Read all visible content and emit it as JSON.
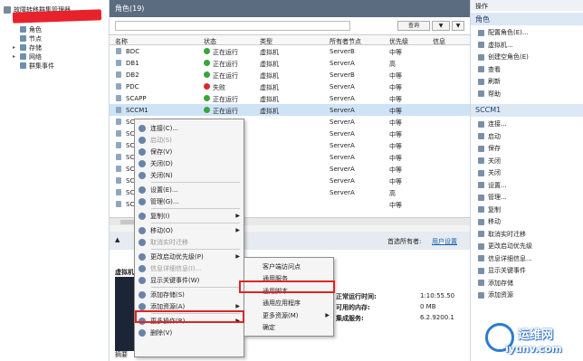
{
  "tree": {
    "root": "故障转移群集管理器",
    "items": [
      {
        "label": "角色",
        "expandable": false
      },
      {
        "label": "节点",
        "expandable": false
      },
      {
        "label": "存储",
        "expandable": true
      },
      {
        "label": "网络",
        "expandable": true
      },
      {
        "label": "群集事件",
        "expandable": false
      }
    ]
  },
  "center": {
    "title": "角色(19)",
    "filter": {
      "placeholder": "",
      "query_btn": "查询",
      "save_btn": "▼",
      "clear_btn": "▼"
    },
    "columns": [
      "名称",
      "状态",
      "类型",
      "所有者节点",
      "优先级",
      "信息"
    ],
    "rows": [
      {
        "name": "BDC",
        "status": "正在运行",
        "type": "虚拟机",
        "owner": "ServerB",
        "priority": "中等",
        "fail": false
      },
      {
        "name": "DB1",
        "status": "正在运行",
        "type": "虚拟机",
        "owner": "ServerA",
        "priority": "高",
        "fail": false
      },
      {
        "name": "DB2",
        "status": "正在运行",
        "type": "虚拟机",
        "owner": "ServerB",
        "priority": "中等",
        "fail": false
      },
      {
        "name": "PDC",
        "status": "失败",
        "type": "虚拟机",
        "owner": "ServerA",
        "priority": "中等",
        "fail": true
      },
      {
        "name": "SCAPP",
        "status": "正在运行",
        "type": "虚拟机",
        "owner": "ServerA",
        "priority": "中等",
        "fail": false
      },
      {
        "name": "SCCM1",
        "status": "正在运行",
        "type": "虚拟机",
        "owner": "ServerA",
        "priority": "中等",
        "fail": false
      },
      {
        "name": "SCD",
        "status": "",
        "type": "",
        "owner": "ServerA",
        "priority": "中等",
        "fail": false
      },
      {
        "name": "SCD",
        "status": "",
        "type": "",
        "owner": "ServerA",
        "priority": "中等",
        "fail": false
      },
      {
        "name": "SCD",
        "status": "",
        "type": "",
        "owner": "ServerA",
        "priority": "中等",
        "fail": false
      },
      {
        "name": "SCD",
        "status": "",
        "type": "",
        "owner": "ServerA",
        "priority": "中等",
        "fail": false
      },
      {
        "name": "SCD",
        "status": "",
        "type": "",
        "owner": "ServerA",
        "priority": "中等",
        "fail": false
      },
      {
        "name": "SCD",
        "status": "",
        "type": "",
        "owner": "ServerA",
        "priority": "中等",
        "fail": false
      },
      {
        "name": "SCD",
        "status": "",
        "type": "",
        "owner": "ServerA",
        "priority": "高",
        "fail": false
      },
      {
        "name": "SCD",
        "status": "",
        "type": "",
        "owner": "",
        "priority": "中等",
        "fail": false
      }
    ],
    "bottom": {
      "preferred_owner_label": "首选所有者:",
      "preferred_owner_link": "用户设置",
      "vm_label": "虚拟机",
      "tab_summary": "摘要",
      "uptime_label": "正常运行时间:",
      "uptime_value": "1:10:55.50",
      "mem_label": "可用的内存:",
      "mem_value": "0 MB",
      "integration_label": "集成服务:",
      "integration_value": "6.2.9200.1"
    }
  },
  "context_menu": [
    {
      "label": "连接(C)...",
      "disabled": false,
      "submenu": false
    },
    {
      "label": "启动(S)",
      "disabled": true,
      "submenu": false
    },
    {
      "label": "保存(V)",
      "disabled": false,
      "submenu": false
    },
    {
      "label": "关闭(D)",
      "disabled": false,
      "submenu": false
    },
    {
      "label": "关闭(N)",
      "disabled": false,
      "submenu": false
    },
    {
      "label": "设置(E)...",
      "disabled": false,
      "submenu": false
    },
    {
      "label": "管理(G)...",
      "disabled": false,
      "submenu": false
    },
    {
      "label": "复制(I)",
      "disabled": false,
      "submenu": true
    },
    {
      "label": "移动(O)",
      "disabled": false,
      "submenu": true
    },
    {
      "label": "取消实时迁移",
      "disabled": true,
      "submenu": false
    },
    {
      "label": "更改启动优先级(P)",
      "disabled": false,
      "submenu": true
    },
    {
      "label": "信息详细信息(I)...",
      "disabled": true,
      "submenu": false
    },
    {
      "label": "显示关键事件(W)",
      "disabled": false,
      "submenu": false
    },
    {
      "label": "添加存储(S)",
      "disabled": false,
      "submenu": false
    },
    {
      "label": "添加资源(A)",
      "disabled": false,
      "submenu": true
    },
    {
      "label": "更多操作(R)",
      "disabled": false,
      "submenu": true
    },
    {
      "label": "删除(V)",
      "disabled": false,
      "submenu": false
    }
  ],
  "submenu": [
    {
      "label": "客户端访问点",
      "submenu": false
    },
    {
      "label": "通用服务",
      "submenu": false
    },
    {
      "label": "通用脚本",
      "submenu": false
    },
    {
      "label": "通用应用程序",
      "submenu": false
    },
    {
      "label": "更多资源(M)",
      "submenu": true
    },
    {
      "label": "确定",
      "submenu": false
    }
  ],
  "actions": {
    "header": "操作",
    "section1": "角色",
    "items1": [
      "配置角色(E)...",
      "虚拟机...",
      "创建空角色(E)",
      "查看",
      "刷新",
      "帮助"
    ],
    "section2": "SCCM1",
    "items2": [
      "连接...",
      "启动",
      "保存",
      "关闭",
      "关闭",
      "设置...",
      "管理...",
      "复制",
      "移动",
      "取消实时迁移",
      "更改启动优先级",
      "信息详细信息...",
      "显示关键事件",
      "添加存储",
      "添加资源"
    ]
  },
  "watermark": {
    "cn": "运维网",
    "url": "iyunv.com"
  }
}
